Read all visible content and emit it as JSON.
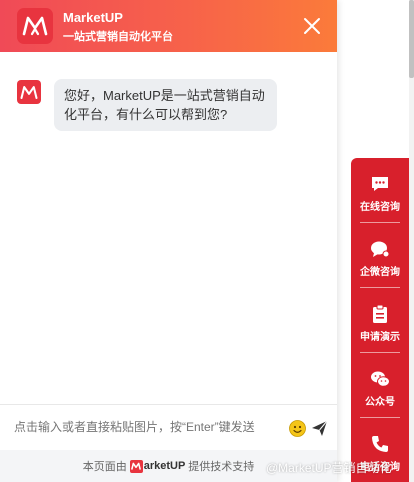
{
  "header": {
    "title": "MarketUP",
    "subtitle": "一站式营销自动化平台",
    "close_icon": "close-icon"
  },
  "messages": [
    {
      "sender": "bot",
      "text": "您好，MarketUP是一站式营销自动化平台，有什么可以帮到您?"
    }
  ],
  "input": {
    "placeholder": "点击输入或者直接粘贴图片，按“Enter”键发送",
    "emoji_icon": "emoji-icon",
    "send_icon": "send-icon"
  },
  "footer": {
    "prefix": "本页面由",
    "brand": "arketUP",
    "suffix": "提供技术支持"
  },
  "side_panel": {
    "items": [
      {
        "label": "在线咨询",
        "icon": "chat-bubble-icon"
      },
      {
        "label": "企微咨询",
        "icon": "wecom-icon"
      },
      {
        "label": "申请演示",
        "icon": "clipboard-icon"
      },
      {
        "label": "公众号",
        "icon": "wechat-icon"
      },
      {
        "label": "电话咨询",
        "icon": "phone-icon"
      }
    ]
  },
  "watermark": "@MarketUP营销自动化",
  "colors": {
    "brand_red": "#e8343f",
    "header_gradient_start": "#f04a57",
    "header_gradient_end": "#fb7b3a",
    "side_panel": "#d8202c"
  }
}
